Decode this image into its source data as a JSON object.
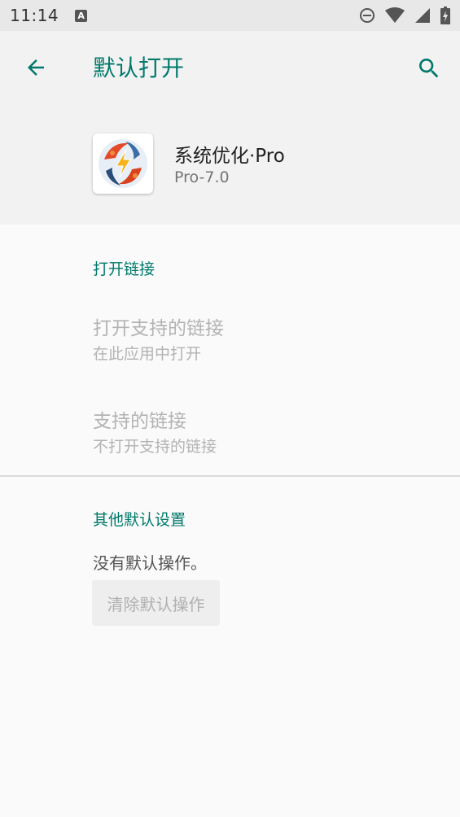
{
  "status_bar": {
    "time": "11:14",
    "notification_icon": "A"
  },
  "toolbar": {
    "title": "默认打开",
    "back_icon": "arrow-back-icon",
    "search_icon": "search-icon"
  },
  "app": {
    "name": "系统优化·Pro",
    "version": "Pro-7.0"
  },
  "open_links": {
    "section_title": "打开链接",
    "items": [
      {
        "title": "打开支持的链接",
        "summary": "在此应用中打开"
      },
      {
        "title": "支持的链接",
        "summary": "不打开支持的链接"
      }
    ]
  },
  "other_defaults": {
    "section_title": "其他默认设置",
    "message": "没有默认操作。",
    "clear_button": "清除默认操作"
  },
  "colors": {
    "accent": "#00796b",
    "disabled_text": "#b3b3b3"
  }
}
